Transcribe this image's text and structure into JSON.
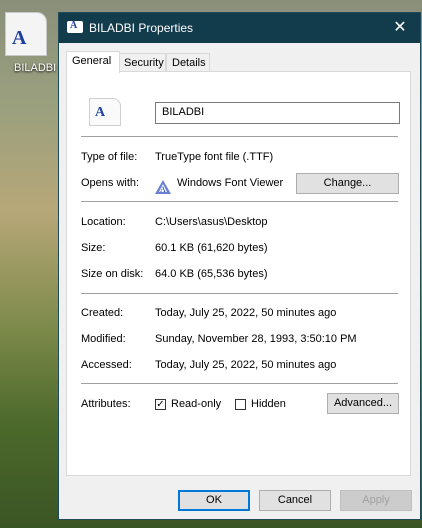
{
  "desktop": {
    "icon_label": "BILADBI",
    "glyph": "A"
  },
  "window": {
    "title": "BILADBI Properties",
    "close_glyph": "✕",
    "icon_glyph": "A"
  },
  "tabs": [
    {
      "label": "General"
    },
    {
      "label": "Security"
    },
    {
      "label": "Details"
    }
  ],
  "general": {
    "icon_glyph": "A",
    "file_name": "BILADBI",
    "type_label": "Type of file:",
    "type_value": "TrueType font file (.TTF)",
    "opens_label": "Opens with:",
    "opens_value": "Windows Font Viewer",
    "change_button": "Change...",
    "location_label": "Location:",
    "location_value": "C:\\Users\\asus\\Desktop",
    "size_label": "Size:",
    "size_value": "60.1 KB (61,620 bytes)",
    "sizeondisk_label": "Size on disk:",
    "sizeondisk_value": "64.0 KB (65,536 bytes)",
    "created_label": "Created:",
    "created_value": "Today, July 25, 2022, 50 minutes ago",
    "modified_label": "Modified:",
    "modified_value": "Sunday, November 28, 1993, 3:50:10 PM",
    "accessed_label": "Accessed:",
    "accessed_value": "Today, July 25, 2022, 50 minutes ago",
    "attributes_label": "Attributes:",
    "readonly_label": "Read-only",
    "readonly_checked": true,
    "hidden_label": "Hidden",
    "hidden_checked": false,
    "advanced_button": "Advanced..."
  },
  "footer": {
    "ok": "OK",
    "cancel": "Cancel",
    "apply": "Apply"
  },
  "colors": {
    "titlebar": "#123b4c",
    "accent": "#0078d7"
  }
}
